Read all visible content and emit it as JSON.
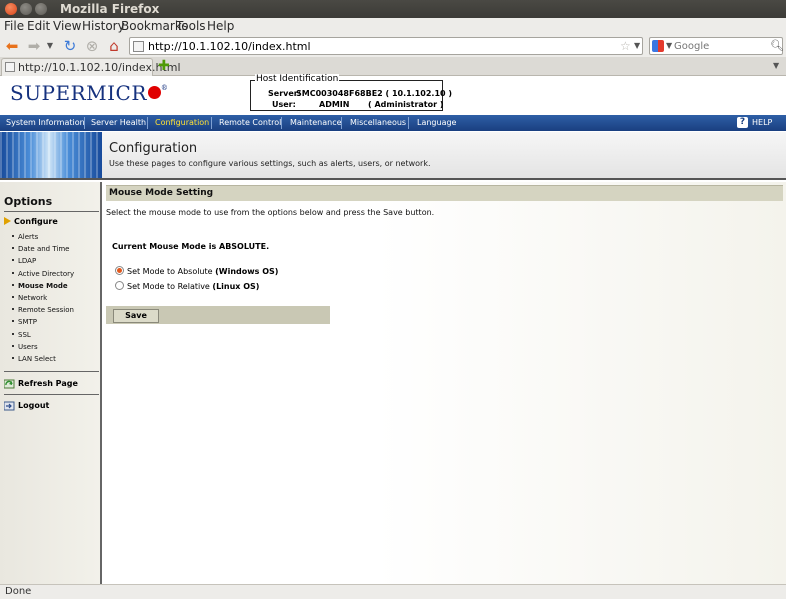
{
  "window": {
    "title": "Mozilla Firefox"
  },
  "menubar": {
    "items": [
      "File",
      "Edit",
      "View",
      "History",
      "Bookmarks",
      "Tools",
      "Help"
    ]
  },
  "navbar": {
    "url": "http://10.1.102.10/index.html",
    "search_placeholder": "Google"
  },
  "tabs": [
    {
      "label": "http://10.1.102.10/index.html"
    }
  ],
  "header": {
    "logo_text": "SUPERMICR",
    "host": {
      "legend": "Host Identification",
      "server_label": "Server:",
      "server_value": "SMC003048F68BE2 (   10.1.102.10   )",
      "user_label": "User:",
      "user_value": "ADMIN",
      "user_role": "( Administrator )"
    }
  },
  "topnav": {
    "items": [
      "System Information",
      "Server Health",
      "Configuration",
      "Remote Control",
      "Maintenance",
      "Miscellaneous",
      "Language"
    ],
    "active": "Configuration",
    "help": "HELP"
  },
  "banner": {
    "title": "Configuration",
    "description": "Use these pages to configure various settings, such as alerts, users, or network."
  },
  "sidebar": {
    "heading": "Options",
    "section": "Configure",
    "items": [
      "Alerts",
      "Date and Time",
      "LDAP",
      "Active Directory",
      "Mouse Mode",
      "Network",
      "Remote Session",
      "SMTP",
      "SSL",
      "Users",
      "LAN Select"
    ],
    "selected": "Mouse Mode",
    "refresh": "Refresh Page",
    "logout": "Logout"
  },
  "content": {
    "header": "Mouse Mode Setting",
    "intro": "Select the mouse mode to use from the options below and press the Save button.",
    "current": "Current Mouse Mode is ABSOLUTE.",
    "options": [
      {
        "label": "Set Mode to Absolute ",
        "os": "(Windows OS)",
        "checked": true
      },
      {
        "label": "Set Mode to Relative ",
        "os": "(Linux OS)",
        "checked": false
      }
    ],
    "save_label": "Save"
  },
  "status": {
    "text": "Done"
  }
}
